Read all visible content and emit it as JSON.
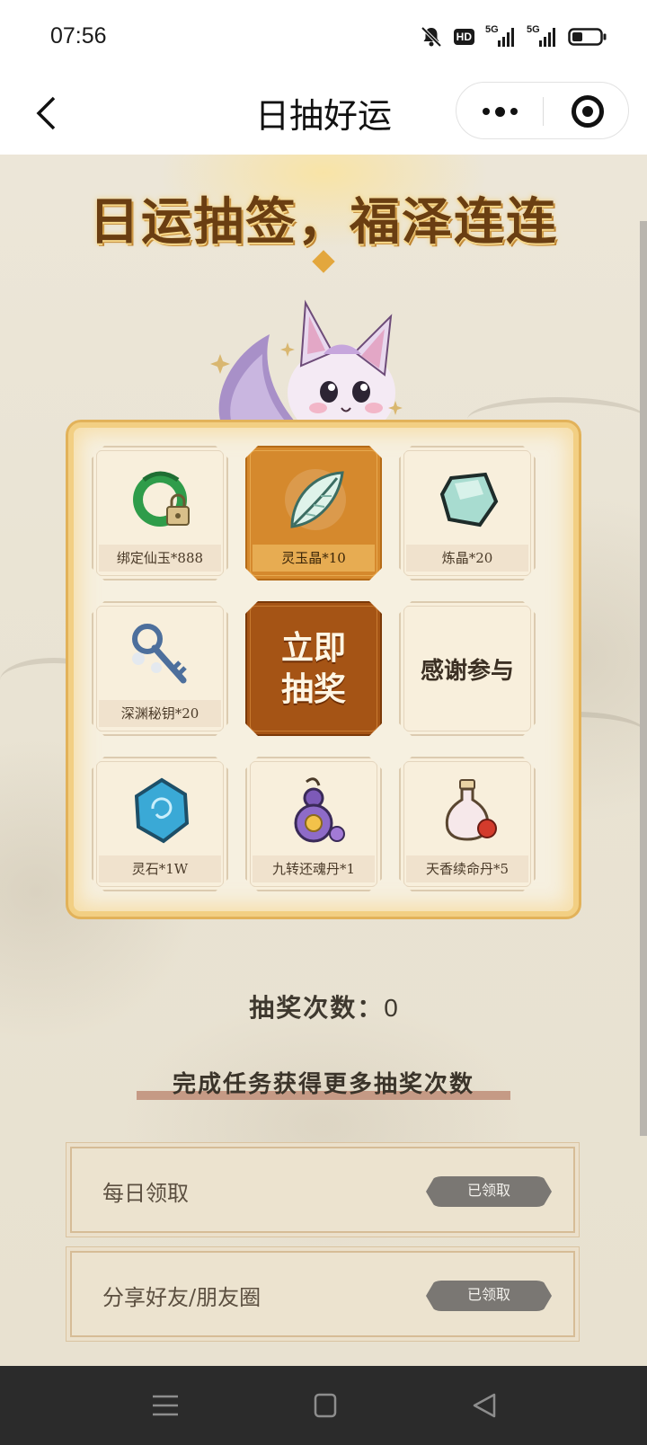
{
  "status_bar": {
    "time": "07:56",
    "hd_label": "HD",
    "signal_1": "5G",
    "signal_2": "5G"
  },
  "nav": {
    "title": "日抽好运"
  },
  "banner": {
    "headline": "日运抽签，福泽连连"
  },
  "prizes": [
    {
      "label": "绑定仙玉*888",
      "icon": "jade-lock-icon",
      "highlighted": false
    },
    {
      "label": "灵玉晶*10",
      "icon": "feather-leaf-icon",
      "highlighted": true
    },
    {
      "label": "炼晶*20",
      "icon": "gem-crystal-icon",
      "highlighted": false
    },
    {
      "label": "深渊秘钥*20",
      "icon": "key-icon",
      "highlighted": false
    },
    {
      "label": "灵石*1W",
      "icon": "spirit-stone-icon",
      "highlighted": false
    },
    {
      "label": "九转还魂丹*1",
      "icon": "gourd-potion-icon",
      "highlighted": false
    },
    {
      "label": "天香续命丹*5",
      "icon": "bottle-icon",
      "highlighted": false
    }
  ],
  "draw_button_label": "立即抽奖",
  "thanks_label": "感谢参与",
  "draw_count": {
    "label": "抽奖次数：",
    "value": "0"
  },
  "tasks_heading": "完成任务获得更多抽奖次数",
  "tasks": [
    {
      "label": "每日领取",
      "button": "已领取"
    },
    {
      "label": "分享好友/朋友圈",
      "button": "已领取"
    }
  ],
  "colors": {
    "board_border": "#f2cf83",
    "active_cell": "#d5892d",
    "draw_button": "#a55415",
    "claimed_button": "#7a7773",
    "headline": "#6a3e12"
  }
}
